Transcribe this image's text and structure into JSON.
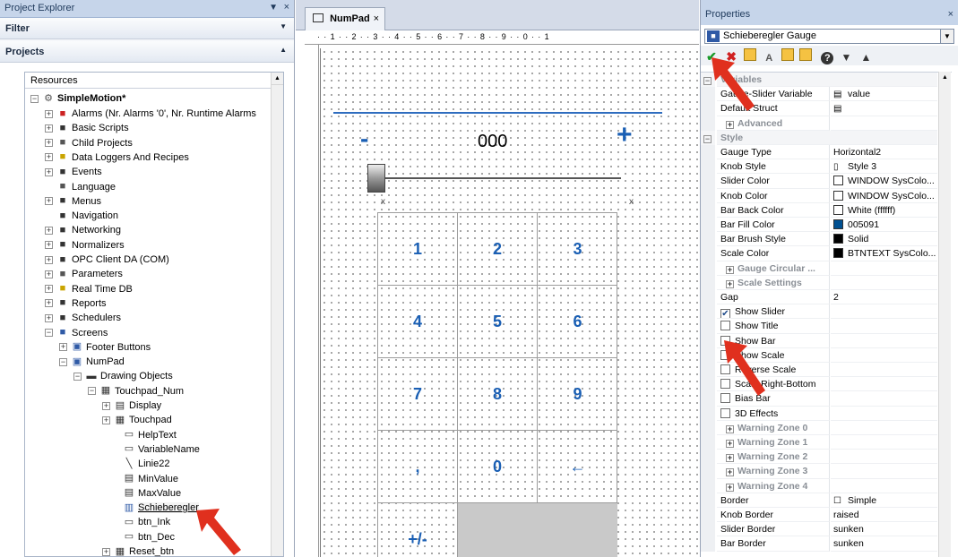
{
  "explorer": {
    "title": "Project Explorer",
    "pin": "\u0013",
    "close": "×",
    "filter_label": "Filter",
    "projects_label": "Projects",
    "tree_header": "Resources",
    "root": "SimpleMotion*",
    "items": [
      {
        "label": "Alarms (Nr. Alarms '0', Nr. Runtime Alarms",
        "icon": "alarm-icon",
        "color": "#cc2222"
      },
      {
        "label": "Basic Scripts",
        "icon": "script-icon",
        "color": "#333333"
      },
      {
        "label": "Child Projects",
        "icon": "gears-icon",
        "color": "#555555"
      },
      {
        "label": "Data Loggers And Recipes",
        "icon": "database-icon",
        "color": "#c9a400"
      },
      {
        "label": "Events",
        "icon": "events-icon",
        "color": "#333333"
      },
      {
        "label": "Language",
        "icon": "language-icon",
        "color": "#555555"
      },
      {
        "label": "Menus",
        "icon": "menu-icon",
        "color": "#333333"
      },
      {
        "label": "Navigation",
        "icon": "navigation-icon",
        "color": "#333333"
      },
      {
        "label": "Networking",
        "icon": "network-icon",
        "color": "#333333"
      },
      {
        "label": "Normalizers",
        "icon": "normalizer-icon",
        "color": "#333333"
      },
      {
        "label": "OPC Client DA (COM)",
        "icon": "opc-icon",
        "color": "#333333"
      },
      {
        "label": "Parameters",
        "icon": "parameters-icon",
        "color": "#555555"
      },
      {
        "label": "Real Time DB",
        "icon": "realtime-db-icon",
        "color": "#c9a400"
      },
      {
        "label": "Reports",
        "icon": "reports-icon",
        "color": "#333333"
      },
      {
        "label": "Schedulers",
        "icon": "clock-icon",
        "color": "#333333"
      },
      {
        "label": "Screens",
        "icon": "screen-icon",
        "color": "#2f5aa6"
      }
    ],
    "screens_children": {
      "footer": "Footer Buttons",
      "numpad": "NumPad",
      "drawing": "Drawing Objects",
      "touchpad_num": "Touchpad_Num",
      "display": "Display",
      "touchpad": "Touchpad",
      "helptext": "HelpText",
      "variablename": "VariableName",
      "linie22": "Linie22",
      "minvalue": "MinValue",
      "maxvalue": "MaxValue",
      "schieberegler": "Schieberegler",
      "btn_ink": "btn_Ink",
      "btn_dec": "btn_Dec",
      "reset_btn": "Reset_btn"
    }
  },
  "editor": {
    "tab_label": "NumPad",
    "tab_close": "×",
    "ruler_h": "· · 1 · · 2 · · 3 · · 4 · · 5 · · 6 · · 7 · · 8 · · 9 · · 0 · · 1",
    "minus": "-",
    "display_value": "000",
    "plus": "+",
    "slider_x": "x",
    "keys": [
      "1",
      "2",
      "3",
      "4",
      "5",
      "6",
      "7",
      "8",
      "9",
      ",",
      "0",
      "←",
      "+/-",
      "",
      ""
    ]
  },
  "properties": {
    "title": "Properties",
    "close": "×",
    "object": "Schieberegler Gauge",
    "toolbar": {
      "apply": "✔",
      "cancel": "✖",
      "help": "?",
      "filter": "▼",
      "up": "▲"
    },
    "rows": [
      {
        "type": "cat",
        "name": "Variables",
        "expander": "−"
      },
      {
        "type": "prop",
        "name": "Gauge-Slider Variable",
        "value": "value",
        "vicon": "var"
      },
      {
        "type": "prop",
        "name": "Default Struct",
        "value": "",
        "vicon": "var"
      },
      {
        "type": "sub",
        "name": "Advanced"
      },
      {
        "type": "cat",
        "name": "Style",
        "expander": "−"
      },
      {
        "type": "prop",
        "name": "Gauge Type",
        "value": "Horizontal2"
      },
      {
        "type": "prop",
        "name": "Knob Style",
        "value": "Style 3",
        "vicon": "knob"
      },
      {
        "type": "prop",
        "name": "Slider Color",
        "value": "WINDOW SysColo...",
        "swatch": "#ffffff"
      },
      {
        "type": "prop",
        "name": "Knob Color",
        "value": "WINDOW SysColo...",
        "swatch": "#ffffff"
      },
      {
        "type": "prop",
        "name": "Bar Back Color",
        "value": "White (ffffff)",
        "swatch": "#ffffff"
      },
      {
        "type": "prop",
        "name": "Bar Fill Color",
        "value": "005091",
        "swatch": "#005091"
      },
      {
        "type": "prop",
        "name": "Bar Brush Style",
        "value": "Solid",
        "swatch": "#000000"
      },
      {
        "type": "prop",
        "name": "Scale Color",
        "value": "BTNTEXT SysColo...",
        "swatch": "#000000"
      },
      {
        "type": "sub",
        "name": "Gauge Circular ..."
      },
      {
        "type": "sub",
        "name": "Scale Settings"
      },
      {
        "type": "prop",
        "name": "Gap",
        "value": "2"
      },
      {
        "type": "check",
        "name": "Show Slider",
        "checked": true
      },
      {
        "type": "check",
        "name": "Show Title",
        "checked": false
      },
      {
        "type": "check",
        "name": "Show Bar",
        "checked": false
      },
      {
        "type": "check",
        "name": "Show Scale",
        "checked": false
      },
      {
        "type": "check",
        "name": "Reverse Scale",
        "checked": false
      },
      {
        "type": "check",
        "name": "Scale Right-Bottom",
        "checked": false
      },
      {
        "type": "check",
        "name": "Bias Bar",
        "checked": false
      },
      {
        "type": "check",
        "name": "3D Effects",
        "checked": false
      },
      {
        "type": "sub",
        "name": "Warning Zone 0"
      },
      {
        "type": "sub",
        "name": "Warning Zone 1"
      },
      {
        "type": "sub",
        "name": "Warning Zone 2"
      },
      {
        "type": "sub",
        "name": "Warning Zone 3"
      },
      {
        "type": "sub",
        "name": "Warning Zone 4"
      },
      {
        "type": "prop",
        "name": "Border",
        "value": "Simple",
        "vicon": "box"
      },
      {
        "type": "prop",
        "name": "Knob Border",
        "value": "raised"
      },
      {
        "type": "prop",
        "name": "Slider Border",
        "value": "sunken"
      },
      {
        "type": "prop",
        "name": "Bar Border",
        "value": "sunken"
      }
    ]
  },
  "colors": {
    "accent": "#1a5fb4",
    "arrow": "#e0301e",
    "title_bar": "#c6d5ea"
  }
}
